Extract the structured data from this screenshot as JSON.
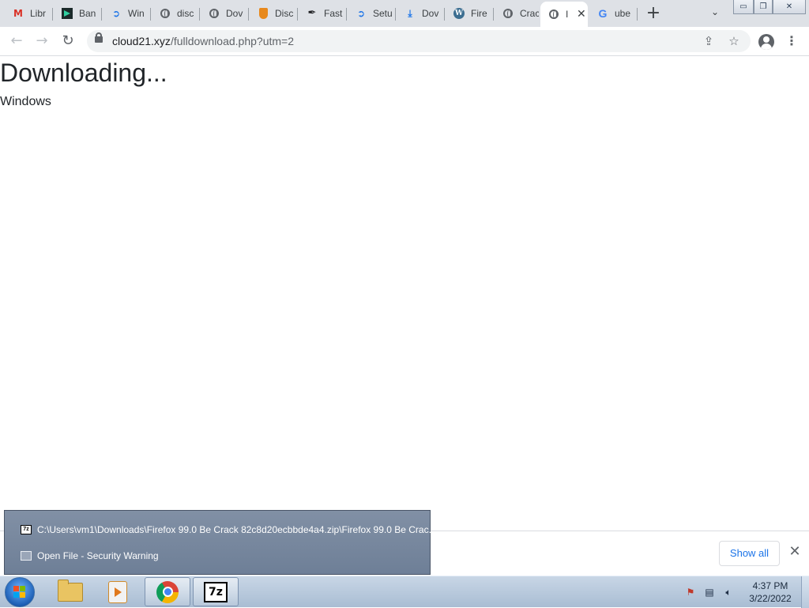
{
  "browser": {
    "tabs": [
      {
        "favicon": "gmail-icon",
        "title": "Libr"
      },
      {
        "favicon": "bandcamp-icon",
        "title": "Ban"
      },
      {
        "favicon": "edge-style-icon",
        "title": "Win"
      },
      {
        "favicon": "globe-icon",
        "title": "disc"
      },
      {
        "favicon": "globe-icon",
        "title": "Dov"
      },
      {
        "favicon": "shield-icon",
        "title": "Disc"
      },
      {
        "favicon": "feather-icon",
        "title": "Fast"
      },
      {
        "favicon": "edge-style-icon",
        "title": "Setu"
      },
      {
        "favicon": "download-icon",
        "title": "Dov"
      },
      {
        "favicon": "wordpress-icon",
        "title": "Fire"
      },
      {
        "favicon": "globe-icon",
        "title": "Crac"
      },
      {
        "favicon": "globe-icon",
        "title": "I",
        "active": true
      },
      {
        "favicon": "google-icon",
        "title": "ube"
      }
    ],
    "new_tab_symbol": "+",
    "tab_search_symbol": "⌄",
    "window_controls": {
      "minimize": "▭",
      "restore": "❐",
      "close": "✕"
    },
    "address": {
      "domain": "cloud21.xyz",
      "path": "/fulldownload.php?utm=2"
    },
    "nav": {
      "back": "←",
      "forward": "→",
      "reload": "↻"
    },
    "omnibox_icons": {
      "share": "⇪",
      "bookmark": "☆"
    },
    "menu_symbol": "⋮"
  },
  "page": {
    "heading": "Downloading...",
    "os_label": "Windows"
  },
  "download_shelf": {
    "show_all_label": "Show all",
    "close_symbol": "✕"
  },
  "jump_list": {
    "items": [
      {
        "icon": "7zip-icon",
        "label": "C:\\Users\\vm1\\Downloads\\Firefox 99.0 Be Crack 82c8d20ecbbde4a4.zip\\Firefox 99.0 Be Crac..."
      },
      {
        "icon": "window-icon",
        "label": "Open File - Security Warning"
      }
    ]
  },
  "taskbar": {
    "pinned": [
      "windows-explorer-icon",
      "media-player-icon",
      "chrome-icon",
      "7zip-icon"
    ],
    "seven_zip_text": "7z",
    "clock": {
      "time": "4:37 PM",
      "date": "3/22/2022"
    }
  },
  "colors": {
    "tabstrip_bg": "#dee1e6",
    "link_blue": "#1a73e8",
    "taskbar_bg": "#b8c9dc",
    "jumplist_bg": "#7687a0"
  }
}
